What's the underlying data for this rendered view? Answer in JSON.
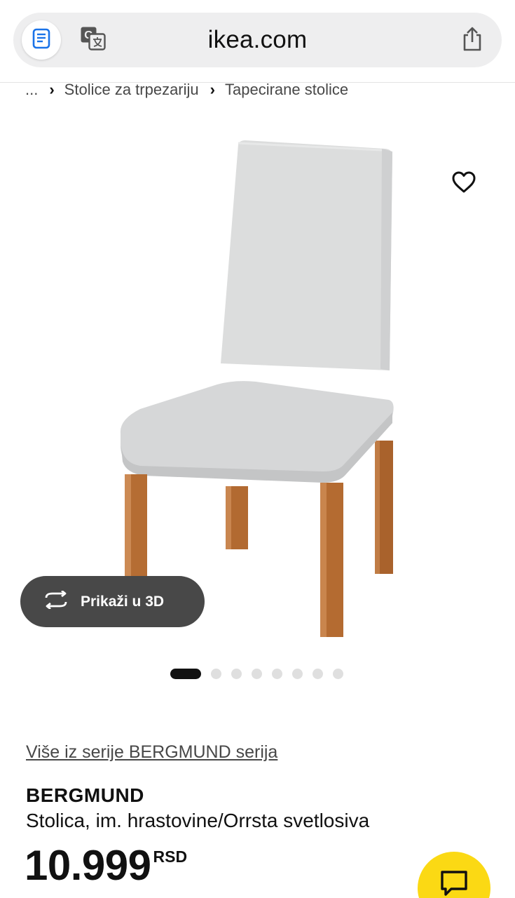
{
  "browser": {
    "url": "ikea.com",
    "reader_icon": "reader-icon",
    "translate_icon": "translate-icon",
    "share_icon": "share-icon"
  },
  "breadcrumb": {
    "ellipsis": "...",
    "items": [
      "Stolice za trpezariju",
      "Tapecirane stolice"
    ]
  },
  "gallery": {
    "view3d_label": "Prikaži u 3D",
    "favorite_icon": "heart-icon",
    "rotate_icon": "rotate-3d-icon",
    "image_count": 8,
    "active_index": 0
  },
  "product": {
    "series_link": "Više iz serije BERGMUND serija",
    "name": "BERGMUND",
    "description": "Stolica, im. hrastovine/Orrsta svetlosiva",
    "price": "10.999",
    "currency": "RSD"
  },
  "chat": {
    "icon": "chat-icon",
    "color": "#fbd914"
  },
  "colors": {
    "button_dark": "#484848",
    "active_dot": "#111111",
    "inactive_dot": "#dfdfdf",
    "chair_fabric": "#d9dadb",
    "chair_wood": "#b66d32"
  }
}
